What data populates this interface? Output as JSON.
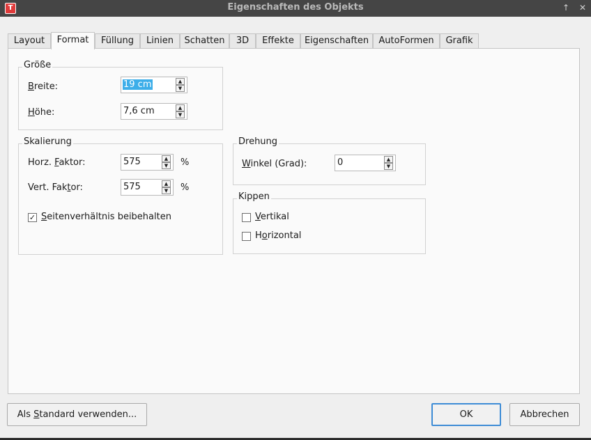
{
  "window": {
    "title": "Eigenschaften des Objekts",
    "app_icon_letter": "T"
  },
  "tabs": [
    {
      "label": "Layout"
    },
    {
      "label": "Format",
      "active": true
    },
    {
      "label": "Füllung"
    },
    {
      "label": "Linien"
    },
    {
      "label": "Schatten"
    },
    {
      "label": "3D"
    },
    {
      "label": "Effekte"
    },
    {
      "label": "Eigenschaften"
    },
    {
      "label": "AutoFormen"
    },
    {
      "label": "Grafik"
    }
  ],
  "size": {
    "title": "Größe",
    "width_label_key": "B",
    "width_label_rest": "reite:",
    "width_value": "19 cm",
    "height_label_key": "H",
    "height_label_rest": "öhe:",
    "height_value": "7,6 cm"
  },
  "scaling": {
    "title": "Skalierung",
    "horz_label_pre": "Horz. ",
    "horz_label_key": "F",
    "horz_label_rest": "aktor:",
    "horz_value": "575",
    "horz_unit": "%",
    "vert_label_pre": "Vert. Fak",
    "vert_label_key": "t",
    "vert_label_rest": "or:",
    "vert_value": "575",
    "vert_unit": "%",
    "keep_ratio_key": "S",
    "keep_ratio_rest": "eitenverhältnis beibehalten",
    "keep_ratio_checked": true
  },
  "rotation": {
    "title": "Drehung",
    "angle_label_key": "W",
    "angle_label_rest": "inkel (Grad):",
    "angle_value": "0"
  },
  "flip": {
    "title": "Kippen",
    "vertical_key": "V",
    "vertical_rest": "ertikal",
    "vertical_checked": false,
    "horizontal_pre": "H",
    "horizontal_key": "o",
    "horizontal_rest": "rizontal",
    "horizontal_checked": false
  },
  "buttons": {
    "default_pre": "Als ",
    "default_key": "S",
    "default_rest": "tandard verwenden...",
    "ok": "OK",
    "cancel": "Abbrechen"
  },
  "colors": {
    "selection": "#3daee9",
    "default_button_border": "#3d8cd6",
    "titlebar": "#454545"
  }
}
